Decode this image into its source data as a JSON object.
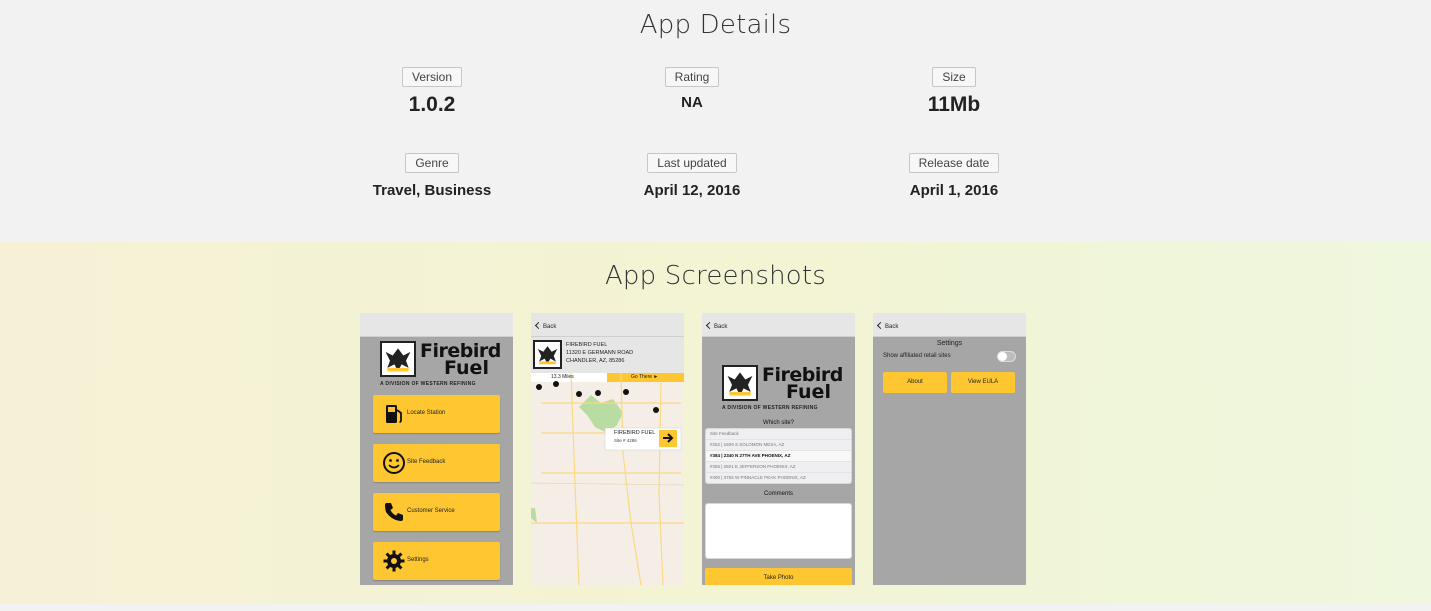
{
  "details": {
    "title": "App Details",
    "items": [
      {
        "label": "Version",
        "value": "1.0.2"
      },
      {
        "label": "Rating",
        "value": "NA"
      },
      {
        "label": "Size",
        "value": "11Mb"
      },
      {
        "label": "Genre",
        "value": "Travel, Business"
      },
      {
        "label": "Last updated",
        "value": "April 12, 2016"
      },
      {
        "label": "Release date",
        "value": "April 1, 2016"
      }
    ]
  },
  "screenshots": {
    "title": "App Screenshots",
    "brand": {
      "line1": "Firebird",
      "line2": "Fuel",
      "division": "A DIVISION OF WESTERN REFINING",
      "accent_color": "#fec630"
    },
    "screen1": {
      "menu": [
        {
          "label": "Locate Station",
          "icon": "gas-pump-icon"
        },
        {
          "label": "Site Feedback",
          "icon": "smiley-icon"
        },
        {
          "label": "Customer Service",
          "icon": "phone-icon"
        },
        {
          "label": "Settings",
          "icon": "gear-icon"
        }
      ]
    },
    "screen2": {
      "back": "Back",
      "address": [
        "FIREBIRD FUEL",
        "11320 E GERMANN ROAD",
        "CHANDLER, AZ, 85286"
      ],
      "distance": "13.3 Miles",
      "go_there": "Go There ►",
      "callout_name": "FIREBIRD FUEL",
      "callout_site": "Site # 4286"
    },
    "screen3": {
      "back": "Back",
      "which_site": "Which site?",
      "sites": [
        "Site Feedback",
        "#262 | 1609 S SOLOMON MESA, AZ",
        "#384 | 2340 N 27TH AVE PHOENIX, AZ",
        "#355 | 2601 E JEFFERSON PHOENIX, AZ",
        "#400 | 3755 W PINNACLE PEAK PHOENIX, AZ"
      ],
      "comments": "Comments",
      "take_photo": "Take Photo"
    },
    "screen4": {
      "back": "Back",
      "title": "Settings",
      "toggle_label": "Show affiliated retail sites",
      "about": "About",
      "eula": "View EULA"
    }
  }
}
